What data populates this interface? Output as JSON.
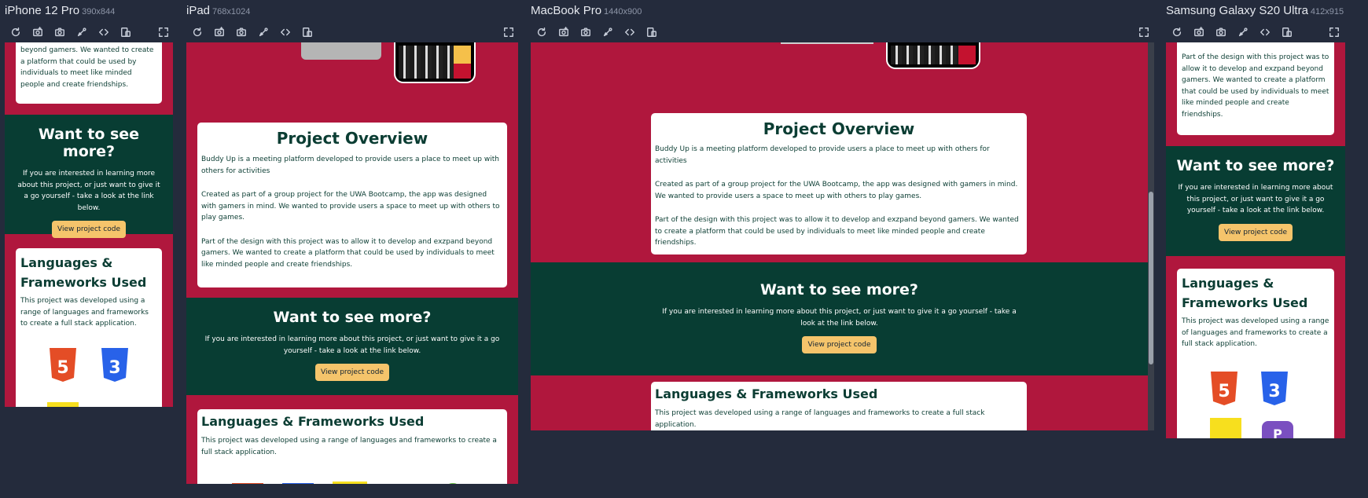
{
  "devices": {
    "iphone": {
      "name": "iPhone 12 Pro",
      "size": "390x844"
    },
    "ipad": {
      "name": "iPad",
      "size": "768x1024"
    },
    "macbook": {
      "name": "MacBook Pro",
      "size": "1440x900"
    },
    "galaxy": {
      "name": "Samsung Galaxy S20 Ultra",
      "size": "412x915"
    }
  },
  "toolbar_icons": [
    "reload-icon",
    "screenshot-icon",
    "camera-icon",
    "rotate-icon",
    "code-icon",
    "devices-icon",
    "fullscreen-icon"
  ],
  "content": {
    "intro_tail": "beyond gamers. We wanted to create a platform that could be used by individuals to meet like minded people and create friendships.",
    "galaxy_intro_tail": "Part of the design with this project was to allow it to develop and exzpand beyond gamers. We wanted to create a platform that could be used by individuals to meet like minded people and create friendships.",
    "overview_title": "Project Overview",
    "overview_p1": "Buddy Up is a meeting platform developed to provide users a place to meet up with others for activities",
    "overview_p2": "Created as part of a group project for the UWA Bootcamp, the app was designed with gamers in mind. We wanted to provide users a space to meet up with others to play games.",
    "overview_p3": "Part of the design with this project was to allow it to develop and exzpand beyond gamers. We wanted to create a platform that could be used by individuals to meet like minded people and create friendships.",
    "more_title": "Want to see more?",
    "more_text": "If you are interested in learning more about this project, or just want to give it a go yourself - take a look at the link below.",
    "more_button": "View project code",
    "lang_title_split": [
      "Languages &",
      "Frameworks Used"
    ],
    "lang_title": "Languages & Frameworks Used",
    "lang_text": "This project was developed using a range of languages and frameworks to create a full stack application."
  },
  "logos": {
    "html": "5",
    "css": "3",
    "js": "",
    "php": "P"
  },
  "colors": {
    "page_bg": "#242b3c",
    "section_red": "#b0173d",
    "section_green": "#083d33",
    "button": "#f5c46b",
    "heading": "#0b3d33"
  }
}
